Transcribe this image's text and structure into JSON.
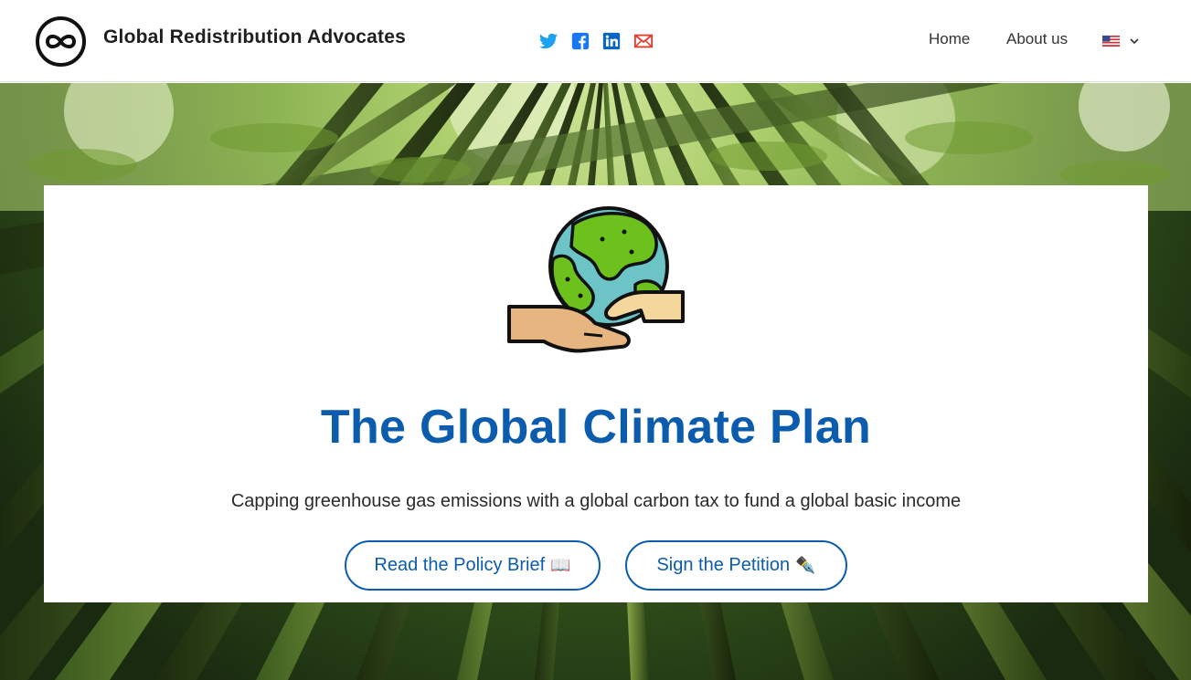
{
  "header": {
    "brand": "Global Redistribution Advocates",
    "social": [
      {
        "name": "twitter-icon",
        "color": "#1da1f2"
      },
      {
        "name": "facebook-icon",
        "color": "#1877f2"
      },
      {
        "name": "linkedin-icon",
        "color": "#0a66c2"
      },
      {
        "name": "mail-icon",
        "color": "#e03b2e"
      }
    ],
    "nav": {
      "home": "Home",
      "about": "About us"
    },
    "language": {
      "icon": "us-flag-icon",
      "dropdown_icon": "chevron-down-icon"
    }
  },
  "hero": {
    "title": "The Global Climate Plan",
    "subtitle": "Capping greenhouse gas emissions with a global carbon tax to fund a global basic income",
    "buttons": {
      "policy_brief": {
        "label": "Read the Policy Brief",
        "emoji": "📖"
      },
      "petition": {
        "label": "Sign the Petition",
        "emoji": "✒️"
      }
    },
    "accent_color": "#0b5cad"
  }
}
